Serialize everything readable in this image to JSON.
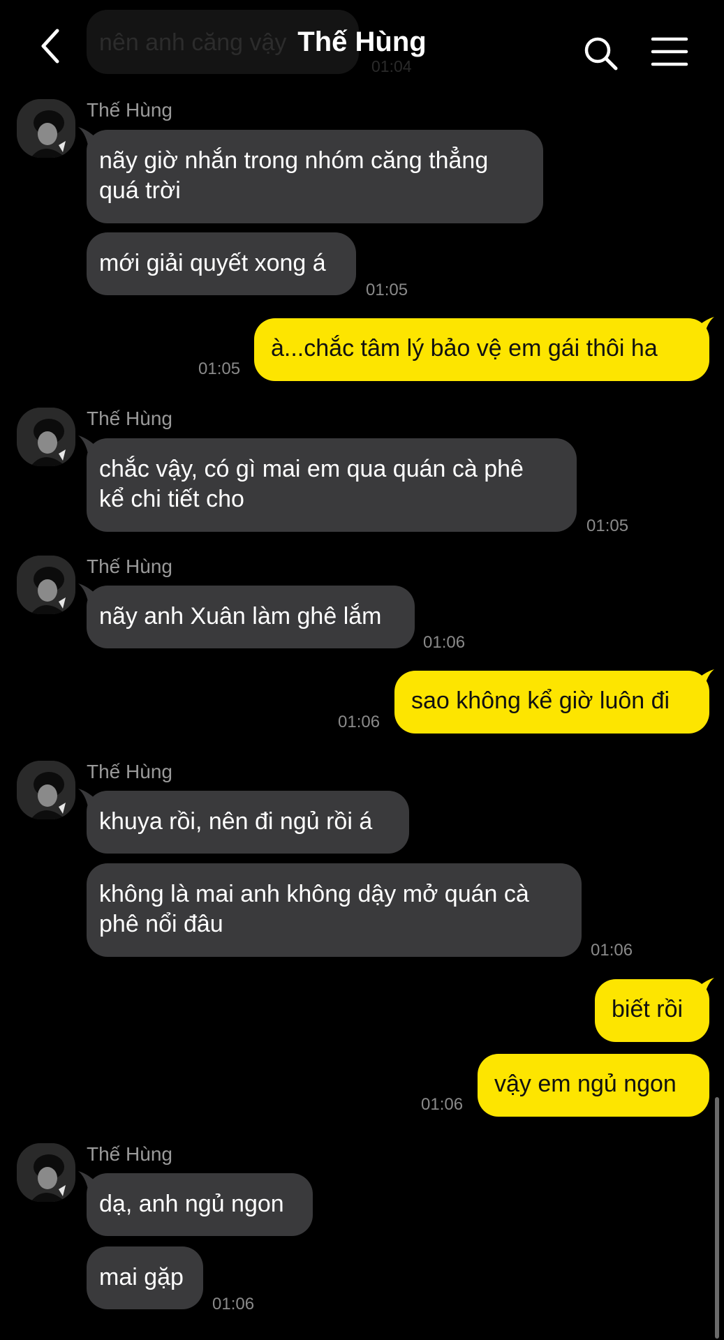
{
  "header": {
    "title": "Thế Hùng",
    "prev_message_text": "nên anh căng vậy",
    "prev_message_time": "01:04"
  },
  "messages": [
    {
      "sender": "Thế Hùng",
      "text": "nãy giờ nhắn trong nhóm căng thẳng quá trời",
      "lines": [
        "nãy giờ nhắn trong nhóm căng thẳng",
        "quá trời"
      ]
    },
    {
      "text": "mới giải quyết xong á",
      "time": "01:05"
    },
    {
      "text": "à...chắc tâm lý bảo vệ em gái thôi ha",
      "time": "01:05"
    },
    {
      "sender": "Thế Hùng",
      "text": "chắc vậy, có gì mai em qua quán cà phê kể chi tiết cho",
      "lines": [
        "chắc vậy, có gì mai em qua quán cà phê",
        "kể chi tiết cho"
      ],
      "time": "01:05"
    },
    {
      "sender": "Thế Hùng",
      "text": "nãy anh Xuân làm ghê lắm",
      "time": "01:06"
    },
    {
      "text": "sao không kể giờ luôn đi",
      "time": "01:06"
    },
    {
      "sender": "Thế Hùng",
      "text": "khuya rồi, nên đi ngủ rồi á"
    },
    {
      "text": "không là mai anh không dậy mở quán cà phê nổi đâu",
      "lines": [
        "không là mai anh không dậy mở quán cà",
        "phê nổi đâu"
      ],
      "time": "01:06"
    },
    {
      "text": "biết rồi"
    },
    {
      "text": "vậy em ngủ ngon",
      "time": "01:06"
    },
    {
      "sender": "Thế Hùng",
      "text": "dạ, anh ngủ ngon"
    },
    {
      "text": "mai gặp",
      "time": "01:06"
    }
  ],
  "colors": {
    "background": "#000000",
    "incoming_bubble": "#3a3a3c",
    "outgoing_bubble": "#fde500",
    "timestamp": "#8a8a8a",
    "sender_name": "#9a9a9a"
  },
  "icons": [
    "back-chevron-icon",
    "search-icon",
    "menu-icon",
    "avatar"
  ]
}
